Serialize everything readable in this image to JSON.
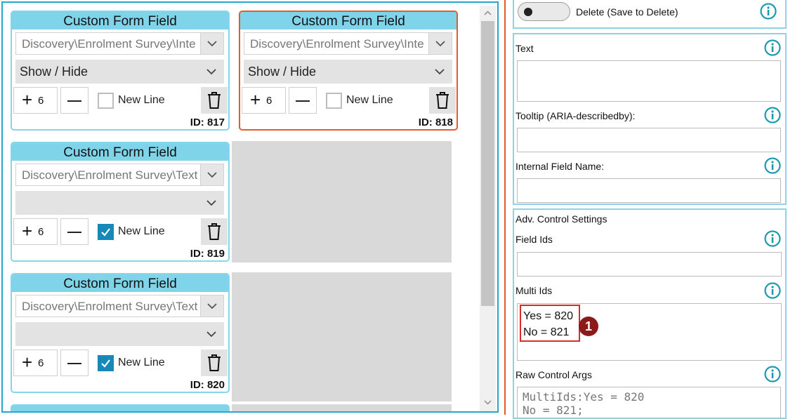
{
  "cards": [
    {
      "title": "Custom Form Field",
      "field_path": "Discovery\\Enrolment Survey\\Inte",
      "mode": "Show / Hide",
      "width": "6",
      "new_line_label": "New Line",
      "new_line_checked": false,
      "id_label": "ID: 817",
      "selected": false
    },
    {
      "title": "Custom Form Field",
      "field_path": "Discovery\\Enrolment Survey\\Inte",
      "mode": "Show / Hide",
      "width": "6",
      "new_line_label": "New Line",
      "new_line_checked": false,
      "id_label": "ID: 818",
      "selected": true
    },
    {
      "title": "Custom Form Field",
      "field_path": "Discovery\\Enrolment Survey\\Text",
      "mode": "",
      "width": "6",
      "new_line_label": "New Line",
      "new_line_checked": true,
      "id_label": "ID: 819",
      "selected": false
    },
    {
      "title": "Custom Form Field",
      "field_path": "Discovery\\Enrolment Survey\\Text",
      "mode": "",
      "width": "6",
      "new_line_label": "New Line",
      "new_line_checked": true,
      "id_label": "ID: 820",
      "selected": false
    }
  ],
  "properties": {
    "delete_toggle_label": "Delete (Save to Delete)",
    "delete_toggle_on": false,
    "text_label": "Text",
    "text_value": "",
    "tooltip_label": "Tooltip (ARIA-describedby):",
    "tooltip_value": "",
    "internal_name_label": "Internal Field Name:",
    "internal_name_value": "",
    "adv_section_title": "Adv. Control Settings",
    "field_ids_label": "Field Ids",
    "field_ids_value": "",
    "multi_ids_label": "Multi Ids",
    "multi_ids_lines": [
      "Yes = 820",
      "No = 821"
    ],
    "callout_number": "1",
    "raw_args_label": "Raw Control Args",
    "raw_args_lines": [
      "MultiIds:Yes = 820",
      "No = 821;"
    ]
  },
  "colors": {
    "accent_border": "#2aa6c9",
    "card_header": "#7fd4ea",
    "selected_border": "#e45a2b",
    "checkbox_checked": "#1689b8",
    "info_icon": "#1f9ab0",
    "callout_red": "#d92b2b",
    "callout_badge": "#8b1a1a"
  },
  "icons": {
    "dropdown": "chevron-down-icon",
    "delete": "trash-icon",
    "info": "info-icon",
    "check": "check-icon"
  }
}
